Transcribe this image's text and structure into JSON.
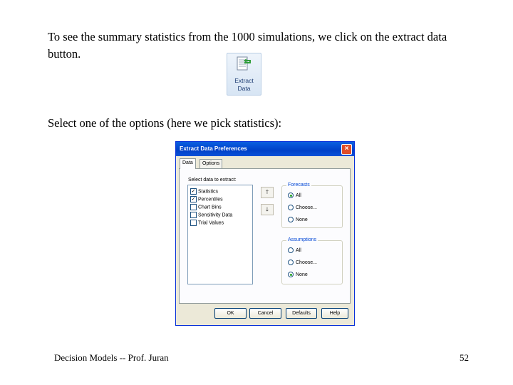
{
  "text": {
    "para1": "To see the summary statistics from the 1000 simulations, we click on the extract data button.",
    "para2": "Select one of the options (here we pick statistics):",
    "footer_left": "Decision Models  --  Prof. Juran",
    "footer_right": "52"
  },
  "extract_button": {
    "line1": "Extract",
    "line2": "Data",
    "icon": "extract-data-icon"
  },
  "dialog": {
    "title": "Extract Data Preferences",
    "close_glyph": "×",
    "tabs": [
      {
        "label": "Data"
      },
      {
        "label": "Options"
      }
    ],
    "select_label": "Select data to extract:",
    "items": [
      {
        "label": "Statistics",
        "checked": true
      },
      {
        "label": "Percentiles",
        "checked": true
      },
      {
        "label": "Chart Bins",
        "checked": false
      },
      {
        "label": "Sensitivity Data",
        "checked": false
      },
      {
        "label": "Trial Values",
        "checked": false
      }
    ],
    "move_up_glyph": "🡑",
    "move_down_glyph": "🡓",
    "forecasts": {
      "label": "Forecasts",
      "options": [
        "All",
        "Choose...",
        "None"
      ],
      "selected": 0
    },
    "assumptions": {
      "label": "Assumptions",
      "options": [
        "All",
        "Choose...",
        "None"
      ],
      "selected": 2
    },
    "buttons": {
      "ok": "OK",
      "cancel": "Cancel",
      "defaults": "Defaults",
      "help": "Help"
    }
  },
  "colors": {
    "title_bar": "#0a5fe0",
    "dialog_bg": "#ece9d8",
    "group_label": "#0046d5"
  }
}
